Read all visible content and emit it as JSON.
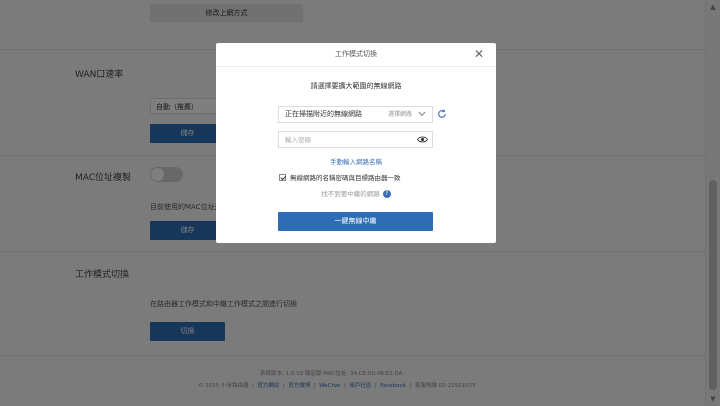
{
  "page": {
    "top_button": "修改上網方式",
    "wan": {
      "title": "WAN口速率",
      "select_value": "自動（推薦）",
      "save_button": "儲存"
    },
    "mac": {
      "title": "MAC位址複製",
      "desc": "目前使用的MAC位址是",
      "save_button": "儲存"
    },
    "mode": {
      "title": "工作模式切換",
      "desc": "在路由器工作模式和中繼工作模式之間進行切換",
      "switch_button": "切換"
    },
    "footer": {
      "version_line": "系統版本: 1.0.10 穩定版  MAC位址: 34:CE:00:48:E2:DA",
      "copyright": "© 2015 小米路由器",
      "links": [
        "官方網站",
        "官方微博",
        "WeChat",
        "用戶社區",
        "Facebook"
      ],
      "hotline": "客服熱線 02-21921025"
    }
  },
  "modal": {
    "title": "工作模式切換",
    "subtitle": "請選擇要擴大範圍的無線網路",
    "scan_label": "正在掃描附近的無線網路",
    "scan_hint": "選擇網路",
    "password_placeholder": "輸入密碼",
    "manual_link": "手動輸入網路名稱",
    "checkbox_label": "無線網路的名稱密碼與目標路由器一致",
    "help_text": "找不到要中繼的網路",
    "primary_button": "一鍵無線中繼"
  },
  "icons": [
    "close-icon",
    "chevron-down-icon",
    "refresh-icon",
    "eye-icon",
    "help-icon"
  ],
  "colors": {
    "accent": "#2d6db5",
    "link": "#3a6fb5",
    "overlay": "rgba(0,0,0,0.5)"
  }
}
